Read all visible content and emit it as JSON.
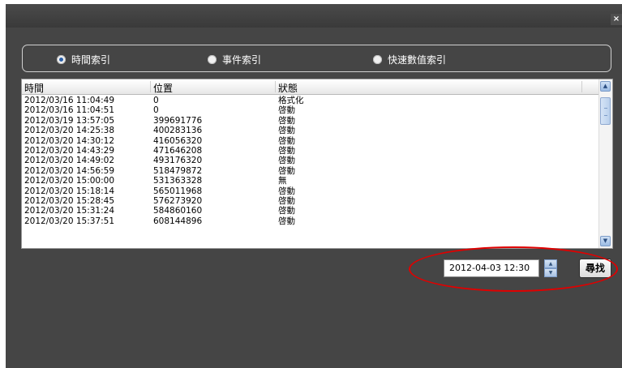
{
  "window": {
    "close_label": "×"
  },
  "radios": [
    {
      "label": "時間索引",
      "selected": true
    },
    {
      "label": "事件索引",
      "selected": false
    },
    {
      "label": "快速數值索引",
      "selected": false
    }
  ],
  "table": {
    "columns": [
      "時間",
      "位置",
      "狀態"
    ],
    "rows": [
      [
        "2012/03/16 11:04:49",
        "0",
        "格式化"
      ],
      [
        "2012/03/16 11:04:51",
        "0",
        "啓動"
      ],
      [
        "2012/03/19 13:57:05",
        "399691776",
        "啓動"
      ],
      [
        "2012/03/20 14:25:38",
        "400283136",
        "啓動"
      ],
      [
        "2012/03/20 14:30:12",
        "416056320",
        "啓動"
      ],
      [
        "2012/03/20 14:43:29",
        "471646208",
        "啓動"
      ],
      [
        "2012/03/20 14:49:02",
        "493176320",
        "啓動"
      ],
      [
        "2012/03/20 14:56:59",
        "518479872",
        "啓動"
      ],
      [
        "2012/03/20 15:00:00",
        "531363328",
        "無"
      ],
      [
        "2012/03/20 15:18:14",
        "565011968",
        "啓動"
      ],
      [
        "2012/03/20 15:28:45",
        "576273920",
        "啓動"
      ],
      [
        "2012/03/20 15:31:24",
        "584860160",
        "啓動"
      ],
      [
        "2012/03/20 15:37:51",
        "608144896",
        "啓動"
      ]
    ],
    "scroll_up": "▲",
    "scroll_down": "▼"
  },
  "search": {
    "datetime_value": "2012-04-03 12:30",
    "spin_up": "▲",
    "spin_down": "▼",
    "find_label": "尋找",
    "highlight_color": "#e00000"
  }
}
